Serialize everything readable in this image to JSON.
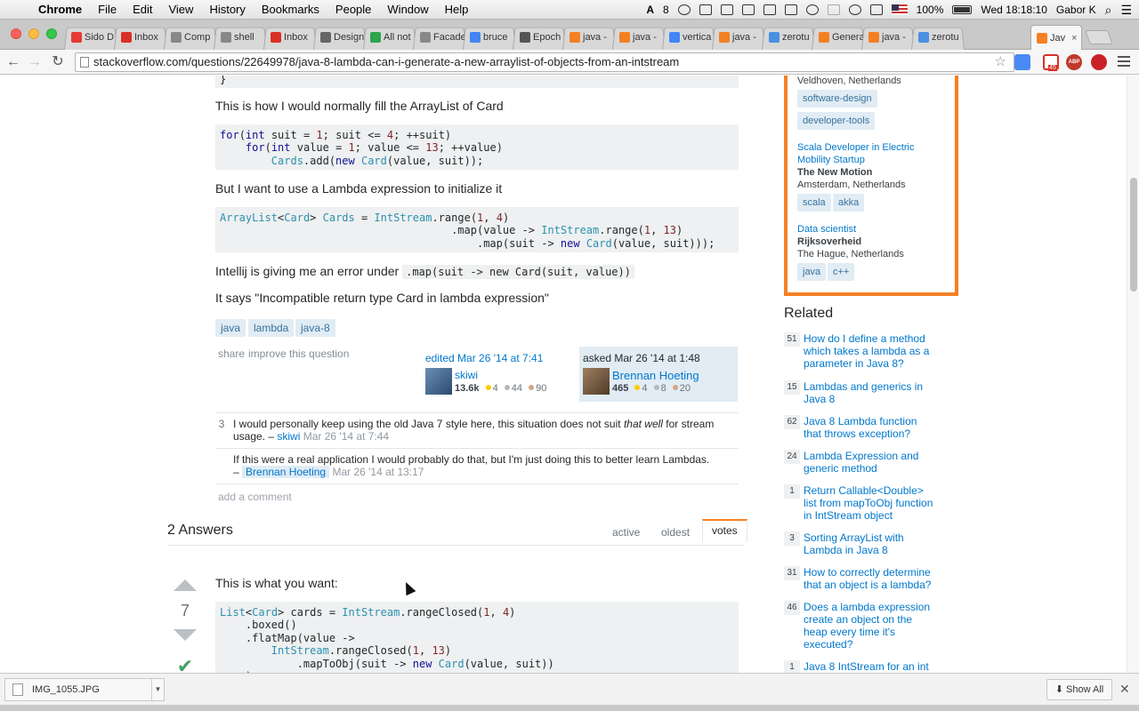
{
  "menubar": {
    "items": [
      "Chrome",
      "File",
      "Edit",
      "View",
      "History",
      "Bookmarks",
      "People",
      "Window",
      "Help"
    ],
    "status": {
      "adobe": "8",
      "battery": "100%",
      "clock": "Wed 18:18:10",
      "user": "Gabor K"
    }
  },
  "tabs": [
    {
      "label": "Sido D",
      "color": "#e53935"
    },
    {
      "label": "Inbox",
      "color": "#d93025"
    },
    {
      "label": "Comp",
      "color": "#888888"
    },
    {
      "label": "shell",
      "color": "#888888"
    },
    {
      "label": "Inbox",
      "color": "#d93025"
    },
    {
      "label": "Design",
      "color": "#666666"
    },
    {
      "label": "All not",
      "color": "#2ea44f"
    },
    {
      "label": "Facade",
      "color": "#888888"
    },
    {
      "label": "bruce",
      "color": "#4285f4"
    },
    {
      "label": "Epoch",
      "color": "#555555"
    },
    {
      "label": "java -",
      "color": "#f48024"
    },
    {
      "label": "java -",
      "color": "#f48024"
    },
    {
      "label": "vertica",
      "color": "#4285f4"
    },
    {
      "label": "java -",
      "color": "#f48024"
    },
    {
      "label": "zerotu",
      "color": "#4a90e2"
    },
    {
      "label": "Genera",
      "color": "#f48024"
    },
    {
      "label": "java -",
      "color": "#f48024"
    },
    {
      "label": "zerotu",
      "color": "#4a90e2"
    }
  ],
  "active_tab": {
    "label": "Jav"
  },
  "toolbar": {
    "url": "stackoverflow.com/questions/22649978/java-8-lambda-can-i-generate-a-new-arraylist-of-objects-from-an-intstream",
    "gmail_badge": "45",
    "abp": "ABP"
  },
  "question": {
    "p1": "This is how I would normally fill the ArrayList of Card",
    "p2": "But I want to use a Lambda expression to initialize it",
    "p3_prefix": "Intellij is giving me an error under",
    "p3_code": ".map(suit -> new Card(suit, value))",
    "p4": "It says \"Incompatible return type Card in lambda expression\"",
    "tags": [
      "java",
      "lambda",
      "java-8"
    ],
    "share": "share",
    "improve": "improve this question",
    "edited": {
      "time": "edited Mar 26 '14 at 7:41",
      "name": "skiwi",
      "rep": "13.6k",
      "gold": "4",
      "silver": "44",
      "bronze": "90"
    },
    "asked": {
      "time": "asked Mar 26 '14 at 1:48",
      "name": "Brennan Hoeting",
      "rep": "465",
      "gold": "4",
      "silver": "8",
      "bronze": "20"
    }
  },
  "comments": [
    {
      "score": "3",
      "text_before": "I would personally keep using the old Java 7 style here, this situation does not suit ",
      "text_em": "that well",
      "text_after": " for stream usage. –",
      "user": "skiwi",
      "date": "Mar 26 '14 at 7:44"
    },
    {
      "score": "",
      "text_before": "If this were a real application I would probably do that, but I'm just doing this to better learn Lambdas. –",
      "user": "Brennan Hoeting",
      "date": "Mar 26 '14 at 13:17"
    }
  ],
  "add_comment": "add a comment",
  "answers": {
    "heading": "2 Answers",
    "sort": [
      "active",
      "oldest",
      "votes"
    ],
    "first": {
      "votes": "7",
      "text": "This is what you want:"
    }
  },
  "jobs": [
    {
      "location": "Veldhoven, Netherlands",
      "tags": [
        "software-design",
        "developer-tools"
      ]
    },
    {
      "title": "Scala Developer in Electric Mobility Startup",
      "company": "The New Motion",
      "location": "Amsterdam, Netherlands",
      "tags": [
        "scala",
        "akka"
      ]
    },
    {
      "title": "Data scientist",
      "company": "Rijksoverheid",
      "location": "The Hague, Netherlands",
      "tags": [
        "java",
        "c++"
      ]
    }
  ],
  "related": {
    "heading": "Related",
    "items": [
      {
        "score": "51",
        "title": "How do I define a method which takes a lambda as a parameter in Java 8?"
      },
      {
        "score": "15",
        "title": "Lambdas and generics in Java 8"
      },
      {
        "score": "62",
        "title": "Java 8 Lambda function that throws exception?"
      },
      {
        "score": "24",
        "title": "Lambda Expression and generic method"
      },
      {
        "score": "1",
        "title": "Return Callable<Double> list from mapToObj function in IntStream object"
      },
      {
        "score": "3",
        "title": "Sorting ArrayList with Lambda in Java 8"
      },
      {
        "score": "31",
        "title": "How to correctly determine that an object is a lambda?"
      },
      {
        "score": "46",
        "title": "Does a lambda expression create an object on the heap every time it's executed?"
      },
      {
        "score": "1",
        "title": "Java 8 IntStream for an int"
      }
    ]
  },
  "downloads": {
    "file": "IMG_1055.JPG",
    "show_all": "Show All"
  }
}
